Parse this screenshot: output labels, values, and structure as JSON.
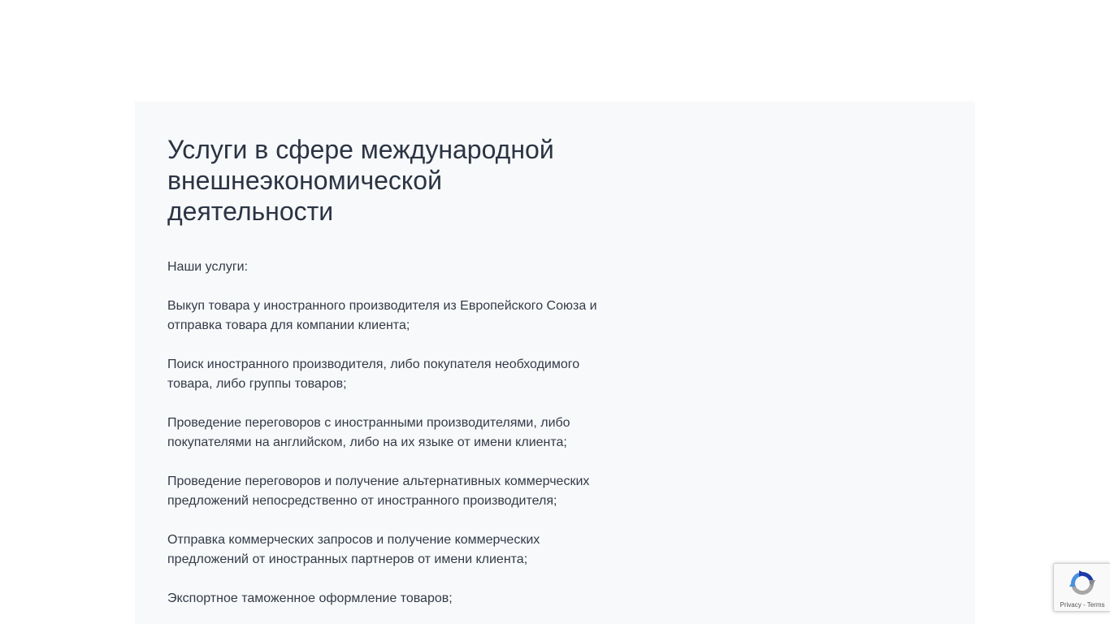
{
  "main": {
    "title": "Услуги в сфере международной внешнеэкономической деятельности",
    "intro": "Наши услуги:",
    "services": [
      "Выкуп товара у иностранного производителя из Европейского Союза и отправка товара для компании клиента;",
      "Поиск иностранного производителя, либо покупателя необходимого товара, либо группы товаров;",
      "Проведение переговоров с иностранными производителями, либо покупателями на английском, либо на их языке от имени клиента;",
      "Проведение переговоров и получение альтернативных коммерческих предложений непосредственно от иностранного производителя;",
      "Отправка коммерческих запросов и получение коммерческих предложений от иностранных партнеров от имени клиента;",
      "Экспортное таможенное оформление товаров;"
    ]
  },
  "recaptcha": {
    "icon": "recaptcha-icon",
    "privacy_label": "Privacy",
    "separator": " - ",
    "terms_label": "Terms"
  },
  "colors": {
    "panel_background": "#f8f9fa",
    "title_text": "#2b3444",
    "body_text": "#333b48"
  }
}
